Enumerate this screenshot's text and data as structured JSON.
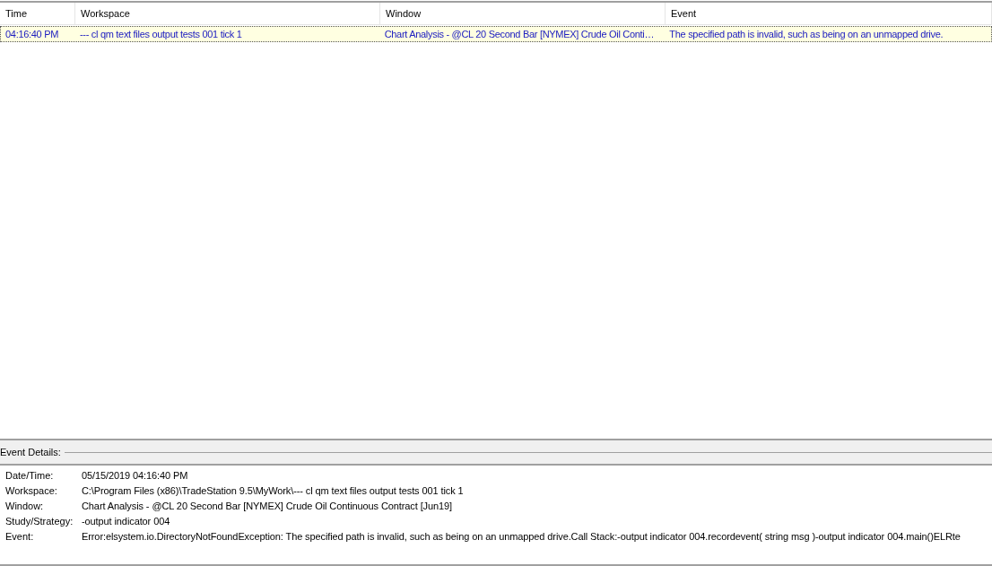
{
  "table": {
    "columns": [
      "Time",
      "Workspace",
      "Window",
      "Event"
    ],
    "rows": [
      {
        "selected": true,
        "cells": [
          "04:16:40 PM",
          "--- cl qm text files output tests 001 tick 1",
          "Chart Analysis - @CL 20 Second Bar [NYMEX] Crude Oil Conti…",
          "The specified path is invalid, such as being on an unmapped drive."
        ]
      }
    ]
  },
  "details": {
    "title": "Event Details:",
    "fields": [
      {
        "label": "Date/Time:",
        "value": "05/15/2019 04:16:40 PM"
      },
      {
        "label": "Workspace:",
        "value": "C:\\Program Files (x86)\\TradeStation 9.5\\MyWork\\--- cl qm text files output tests 001 tick 1"
      },
      {
        "label": "Window:",
        "value": "Chart Analysis - @CL 20 Second Bar [NYMEX] Crude Oil Continuous Contract [Jun19]"
      },
      {
        "label": "Study/Strategy:",
        "value": "-output indicator 004"
      },
      {
        "label": "Event:",
        "value": "Error:elsystem.io.DirectoryNotFoundException: The specified path is invalid, such as being on an unmapped drive.Call Stack:-output indicator 004.recordevent( string msg )-output indicator 004.main()ELRte"
      }
    ]
  }
}
